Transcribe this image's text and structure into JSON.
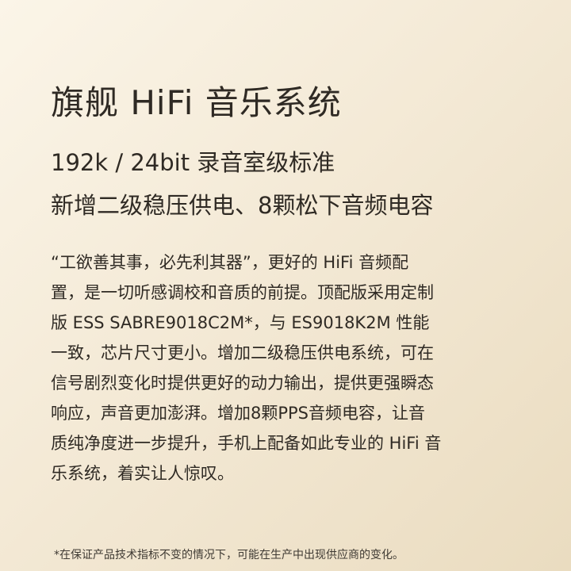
{
  "title": "旗舰 HiFi 音乐系统",
  "subtitle_lines": [
    "192k / 24bit 录音室级标准",
    "新增二级稳压供电、8颗松下音频电容"
  ],
  "body_lines": [
    "“工欲善其事，必先利其器”，更好的 HiFi 音频配",
    "置，是一切听感调校和音质的前提。顶配版采用定制",
    "版 ESS SABRE9018C2M*，与 ES9018K2M 性能",
    "一致，芯片尺寸更小。增加二级稳压供电系统，可在",
    "信号剧烈变化时提供更好的动力输出，提供更强瞬态",
    "响应，声音更加澎湃。增加8颗PPS音频电容，让音",
    "质纯净度进一步提升，手机上配备如此专业的 HiFi 音",
    "乐系统，着实让人惊叹。"
  ],
  "footnote": "*在保证产品技术指标不变的情况下，可能在生产中出现供应商的变化。"
}
